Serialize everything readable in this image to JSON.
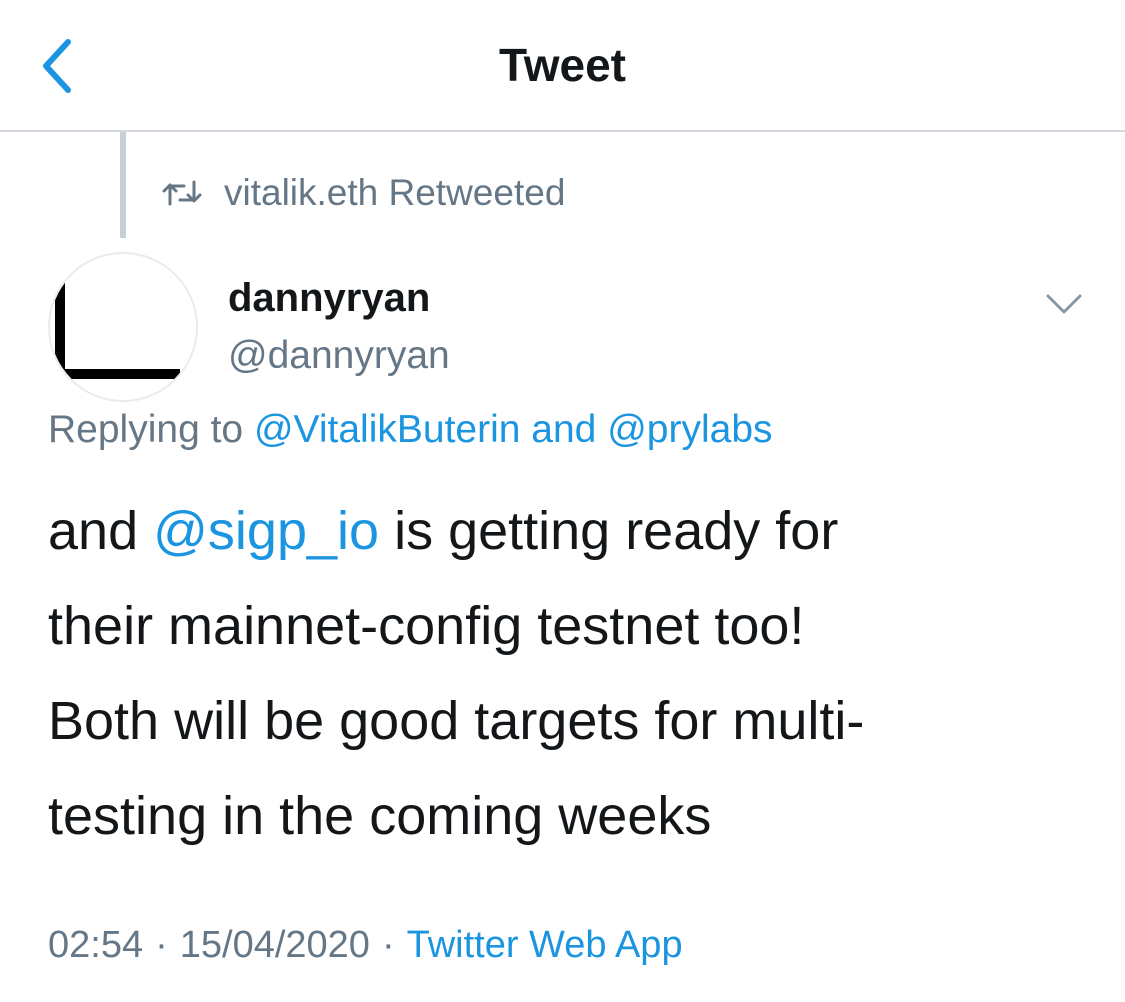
{
  "header": {
    "title": "Tweet",
    "back_icon": "chevron-left-icon"
  },
  "retweet": {
    "icon": "retweet-icon",
    "text": "vitalik.eth Retweeted"
  },
  "author": {
    "name": "dannyryan",
    "handle": "@dannyryan",
    "menu_icon": "chevron-down-icon"
  },
  "reply": {
    "prefix": "Replying to ",
    "mention1": "@VitalikButerin",
    "and": " and ",
    "mention2": "@prylabs"
  },
  "tweet": {
    "line1_pre": "and ",
    "line1_mention": "@sigp_io",
    "line1_post": " is getting ready for",
    "line2": "their mainnet-config testnet too!",
    "line3": "Both will be good targets for multi-",
    "line4": "testing in the coming weeks"
  },
  "meta": {
    "time": "02:54",
    "sep": "·",
    "date": "15/04/2020",
    "source": "Twitter Web App"
  },
  "colors": {
    "accent": "#1b95e0",
    "secondary": "#657786",
    "text": "#14171a",
    "divider": "#d3d9de"
  }
}
